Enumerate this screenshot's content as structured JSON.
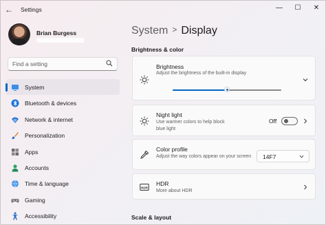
{
  "window": {
    "title": "Settings",
    "back_glyph": "←",
    "minimize_glyph": "—",
    "maximize_glyph": "☐",
    "close_glyph": "✕"
  },
  "profile": {
    "name": "Brian Burgess"
  },
  "search": {
    "placeholder": "Find a setting",
    "value": ""
  },
  "nav": {
    "items": [
      {
        "label": "System",
        "icon": "system-display-icon",
        "selected": true
      },
      {
        "label": "Bluetooth & devices",
        "icon": "bluetooth-icon"
      },
      {
        "label": "Network & internet",
        "icon": "wifi-icon"
      },
      {
        "label": "Personalization",
        "icon": "brush-icon"
      },
      {
        "label": "Apps",
        "icon": "apps-icon"
      },
      {
        "label": "Accounts",
        "icon": "person-icon"
      },
      {
        "label": "Time & language",
        "icon": "globe-clock-icon"
      },
      {
        "label": "Gaming",
        "icon": "gamepad-icon"
      },
      {
        "label": "Accessibility",
        "icon": "accessibility-icon"
      }
    ]
  },
  "breadcrumb": {
    "parent": "System",
    "separator": ">",
    "current": "Display"
  },
  "sections": {
    "brightness_color": "Brightness & color",
    "scale_layout": "Scale & layout"
  },
  "cards": {
    "brightness": {
      "title": "Brightness",
      "description": "Adjust the brightness of the built-in display",
      "level": 0.5
    },
    "night_light": {
      "title": "Night light",
      "description": "Use warmer colors to help block blue light",
      "state_label": "Off",
      "on": false
    },
    "color_profile": {
      "title": "Color profile",
      "description": "Adjust the way colors appear on your screen",
      "selected": "14F7"
    },
    "hdr": {
      "title": "HDR",
      "link": "More about HDR"
    }
  },
  "colors": {
    "accent": "#0067c0"
  }
}
